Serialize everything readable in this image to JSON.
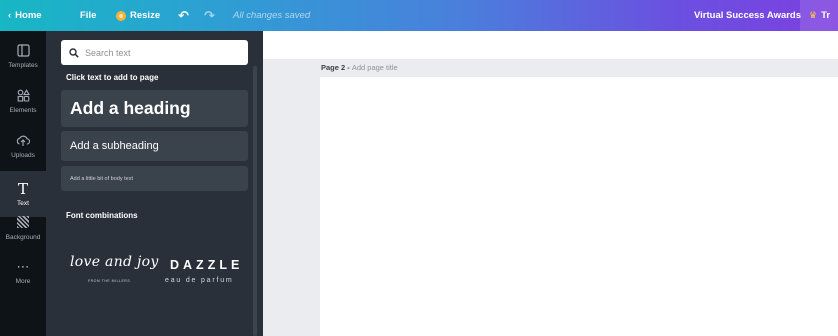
{
  "topbar": {
    "home_label": "Home",
    "file_label": "File",
    "resize_label": "Resize",
    "status_text": "All changes saved",
    "project_title": "Virtual Success Awards",
    "upgrade_label": "Tr"
  },
  "sidebar": {
    "items": [
      {
        "label": "Templates",
        "icon": "templates-icon"
      },
      {
        "label": "Elements",
        "icon": "elements-icon"
      },
      {
        "label": "Uploads",
        "icon": "uploads-icon"
      },
      {
        "label": "Text",
        "icon": "text-icon",
        "active": true
      },
      {
        "label": "Background",
        "icon": "background-icon"
      },
      {
        "label": "More",
        "icon": "more-icon"
      }
    ]
  },
  "panel": {
    "search_placeholder": "Search text",
    "section_title": "Click text to add to page",
    "heading_label": "Add a heading",
    "subheading_label": "Add a subheading",
    "body_label": "Add a little bit of body text",
    "combinations_title": "Font combinations",
    "combos": [
      {
        "main": "love and joy",
        "sub": "FROM THE MILLERS"
      },
      {
        "main": "DAZZLE",
        "sub": "eau de parfum"
      }
    ]
  },
  "page": {
    "label": "Page 2 -",
    "title_placeholder": "Add page title"
  },
  "colors": {
    "topbar_gradient_start": "#17b7c4",
    "topbar_gradient_end": "#7d3fe0",
    "rail_bg": "#0e1318",
    "panel_bg": "#293039",
    "button_bg": "#3a424b",
    "workspace_bg": "#ebecf0"
  }
}
